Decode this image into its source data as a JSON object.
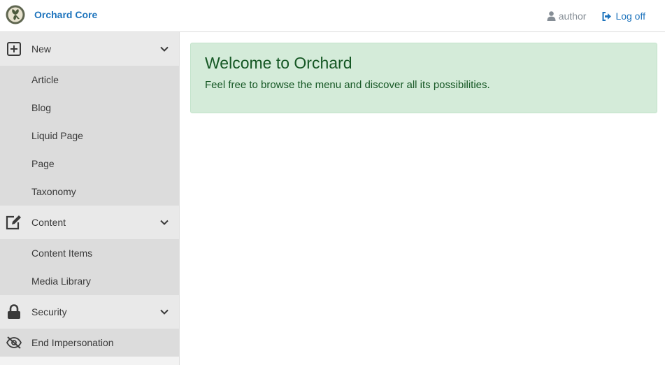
{
  "brand": {
    "name": "Orchard Core",
    "logo_icon": "orchard-logo"
  },
  "user": {
    "name": "author",
    "icon": "user-icon"
  },
  "logoff": {
    "label": "Log off",
    "icon": "sign-out-icon"
  },
  "colors": {
    "brand": "#1e74bd",
    "alert_bg": "#d4ebd9",
    "alert_text": "#155724",
    "sidebar_header": "#e9e9e9",
    "sidebar_sub": "#dcdcdc"
  },
  "sidebar": {
    "groups": [
      {
        "label": "New",
        "icon": "plus-square-icon",
        "items": [
          "Article",
          "Blog",
          "Liquid Page",
          "Page",
          "Taxonomy"
        ]
      },
      {
        "label": "Content",
        "icon": "edit-icon",
        "items": [
          "Content Items",
          "Media Library"
        ]
      },
      {
        "label": "Security",
        "icon": "lock-icon",
        "items": []
      }
    ],
    "end_impersonation": {
      "label": "End Impersonation",
      "icon": "eye-slash-icon"
    }
  },
  "main": {
    "alert": {
      "title": "Welcome to Orchard",
      "text": "Feel free to browse the menu and discover all its possibilities."
    }
  }
}
